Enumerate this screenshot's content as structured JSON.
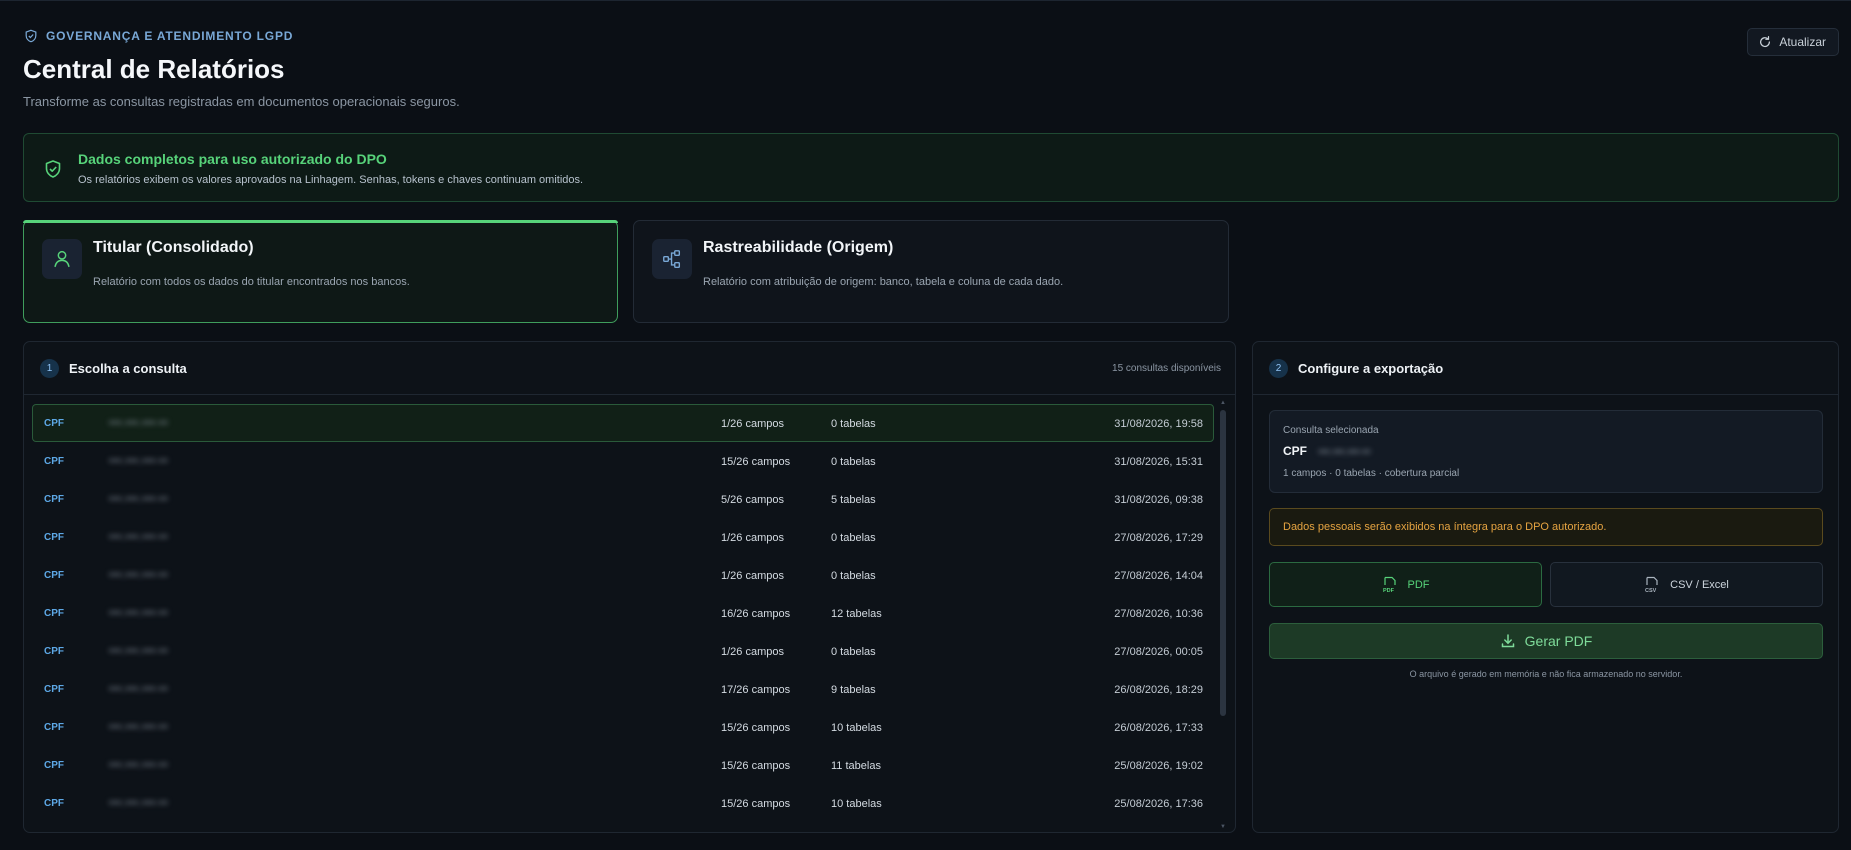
{
  "header": {
    "eyebrow": "GOVERNANÇA E ATENDIMENTO LGPD",
    "title": "Central de Relatórios",
    "subtitle": "Transforme as consultas registradas em documentos operacionais seguros.",
    "refresh_label": "Atualizar"
  },
  "alert": {
    "title": "Dados completos para uso autorizado do DPO",
    "text": "Os relatórios exibem os valores aprovados na Linhagem. Senhas, tokens e chaves continuam omitidos."
  },
  "report_types": [
    {
      "title": "Titular (Consolidado)",
      "description": "Relatório com todos os dados do titular encontrados nos bancos.",
      "icon": "user-icon",
      "selected": true
    },
    {
      "title": "Rastreabilidade (Origem)",
      "description": "Relatório com atribuição de origem: banco, tabela e coluna de cada dado.",
      "icon": "share-nodes-icon",
      "selected": false
    }
  ],
  "queries_panel": {
    "step": "1",
    "title": "Escolha a consulta",
    "available": "15 consultas disponíveis",
    "rows": [
      {
        "type": "CPF",
        "masked": "•••.•••.•••-••",
        "fields": "1/26 campos",
        "tables": "0 tabelas",
        "date": "31/08/2026, 19:58",
        "selected": true
      },
      {
        "type": "CPF",
        "masked": "•••.•••.•••-••",
        "fields": "15/26 campos",
        "tables": "0 tabelas",
        "date": "31/08/2026, 15:31"
      },
      {
        "type": "CPF",
        "masked": "•••.•••.•••-••",
        "fields": "5/26 campos",
        "tables": "5 tabelas",
        "date": "31/08/2026, 09:38"
      },
      {
        "type": "CPF",
        "masked": "•••.•••.•••-••",
        "fields": "1/26 campos",
        "tables": "0 tabelas",
        "date": "27/08/2026, 17:29"
      },
      {
        "type": "CPF",
        "masked": "•••.•••.•••-••",
        "fields": "1/26 campos",
        "tables": "0 tabelas",
        "date": "27/08/2026, 14:04"
      },
      {
        "type": "CPF",
        "masked": "•••.•••.•••-••",
        "fields": "16/26 campos",
        "tables": "12 tabelas",
        "date": "27/08/2026, 10:36"
      },
      {
        "type": "CPF",
        "masked": "•••.•••.•••-••",
        "fields": "1/26 campos",
        "tables": "0 tabelas",
        "date": "27/08/2026, 00:05"
      },
      {
        "type": "CPF",
        "masked": "•••.•••.•••-••",
        "fields": "17/26 campos",
        "tables": "9 tabelas",
        "date": "26/08/2026, 18:29"
      },
      {
        "type": "CPF",
        "masked": "•••.•••.•••-••",
        "fields": "15/26 campos",
        "tables": "10 tabelas",
        "date": "26/08/2026, 17:33"
      },
      {
        "type": "CPF",
        "masked": "•••.•••.•••-••",
        "fields": "15/26 campos",
        "tables": "11 tabelas",
        "date": "25/08/2026, 19:02"
      },
      {
        "type": "CPF",
        "masked": "•••.•••.•••-••",
        "fields": "15/26 campos",
        "tables": "10 tabelas",
        "date": "25/08/2026, 17:36"
      }
    ]
  },
  "export_panel": {
    "step": "2",
    "title": "Configure a exportação",
    "selected_label": "Consulta selecionada",
    "selected_type": "CPF",
    "selected_masked": "•••.•••.•••-••",
    "selected_summary": "1 campos · 0 tabelas · cobertura parcial",
    "warning": "Dados pessoais serão exibidos na íntegra para o DPO autorizado.",
    "format_pdf": "PDF",
    "format_csv": "CSV / Excel",
    "generate_label": "Gerar PDF",
    "note": "O arquivo é gerado em memória e não fica armazenado no servidor."
  },
  "colors": {
    "background": "#0b0f15",
    "success": "#57d37a",
    "accent_blue": "#5da8e6",
    "warning": "#e6a441"
  }
}
